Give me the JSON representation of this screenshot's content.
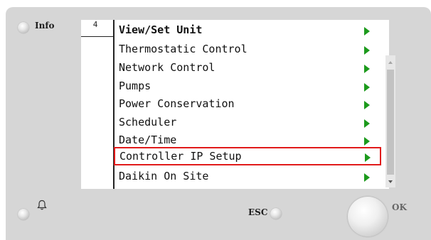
{
  "panel": {
    "info_label": "Info",
    "esc_label": "ESC",
    "ok_label": "OK"
  },
  "screen": {
    "page_number": "4",
    "title": "View/Set Unit",
    "items": [
      {
        "label": "Thermostatic Control"
      },
      {
        "label": "Network Control"
      },
      {
        "label": "Pumps"
      },
      {
        "label": "Power Conservation"
      },
      {
        "label": "Scheduler"
      },
      {
        "label": "Date/Time"
      },
      {
        "label": "Controller IP Setup",
        "highlighted": true
      },
      {
        "label": "Daikin On Site"
      }
    ]
  },
  "colors": {
    "arrow": "#1c9a1c",
    "highlight": "#e11a1a",
    "panel": "#d6d6d6"
  },
  "icons": [
    "led-icon",
    "bell-icon",
    "arrow-right-icon",
    "scroll-up-icon",
    "scroll-down-icon"
  ]
}
